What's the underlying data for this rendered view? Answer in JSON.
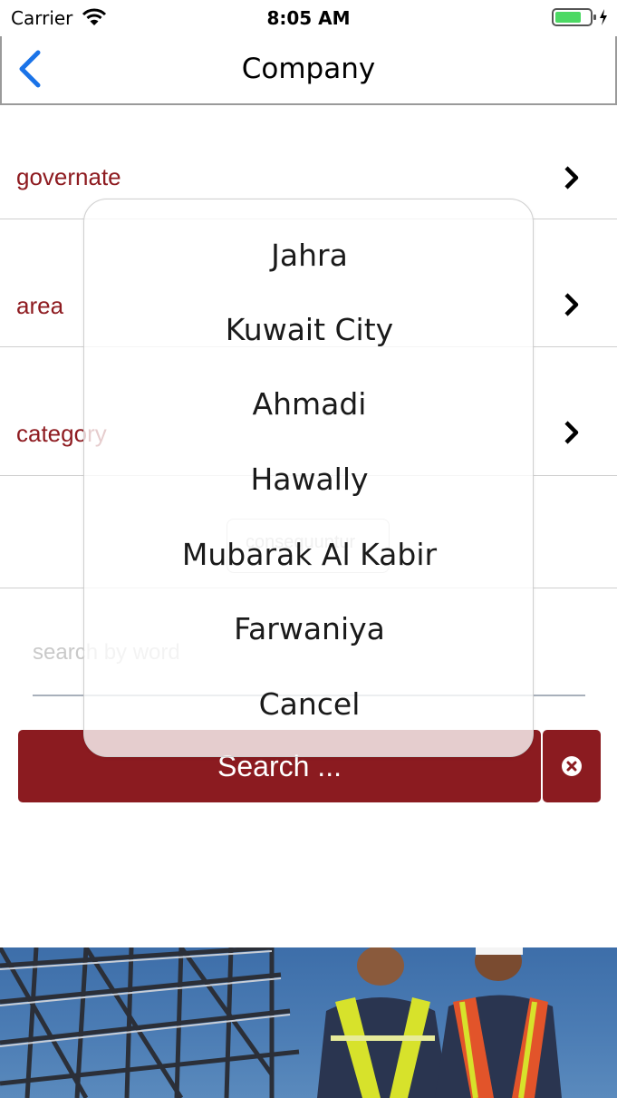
{
  "status_bar": {
    "carrier": "Carrier",
    "time": "8:05 AM"
  },
  "nav": {
    "title": "Company",
    "back_icon": "back-chevron-icon"
  },
  "filters": [
    {
      "label": "governate"
    },
    {
      "label": "area"
    },
    {
      "label": "category"
    }
  ],
  "stepper": {
    "text": "consequuntur"
  },
  "search": {
    "placeholder": "search by word",
    "button_label": "Search ..."
  },
  "action_sheet": {
    "options": [
      "Jahra",
      "Kuwait City",
      "Ahmadi",
      "Hawally",
      "Mubarak Al Kabir",
      "Farwaniya"
    ],
    "cancel_label": "Cancel"
  },
  "colors": {
    "accent": "#8b1b20",
    "label": "#8e1b20",
    "ios_blue": "#1a73e8"
  }
}
